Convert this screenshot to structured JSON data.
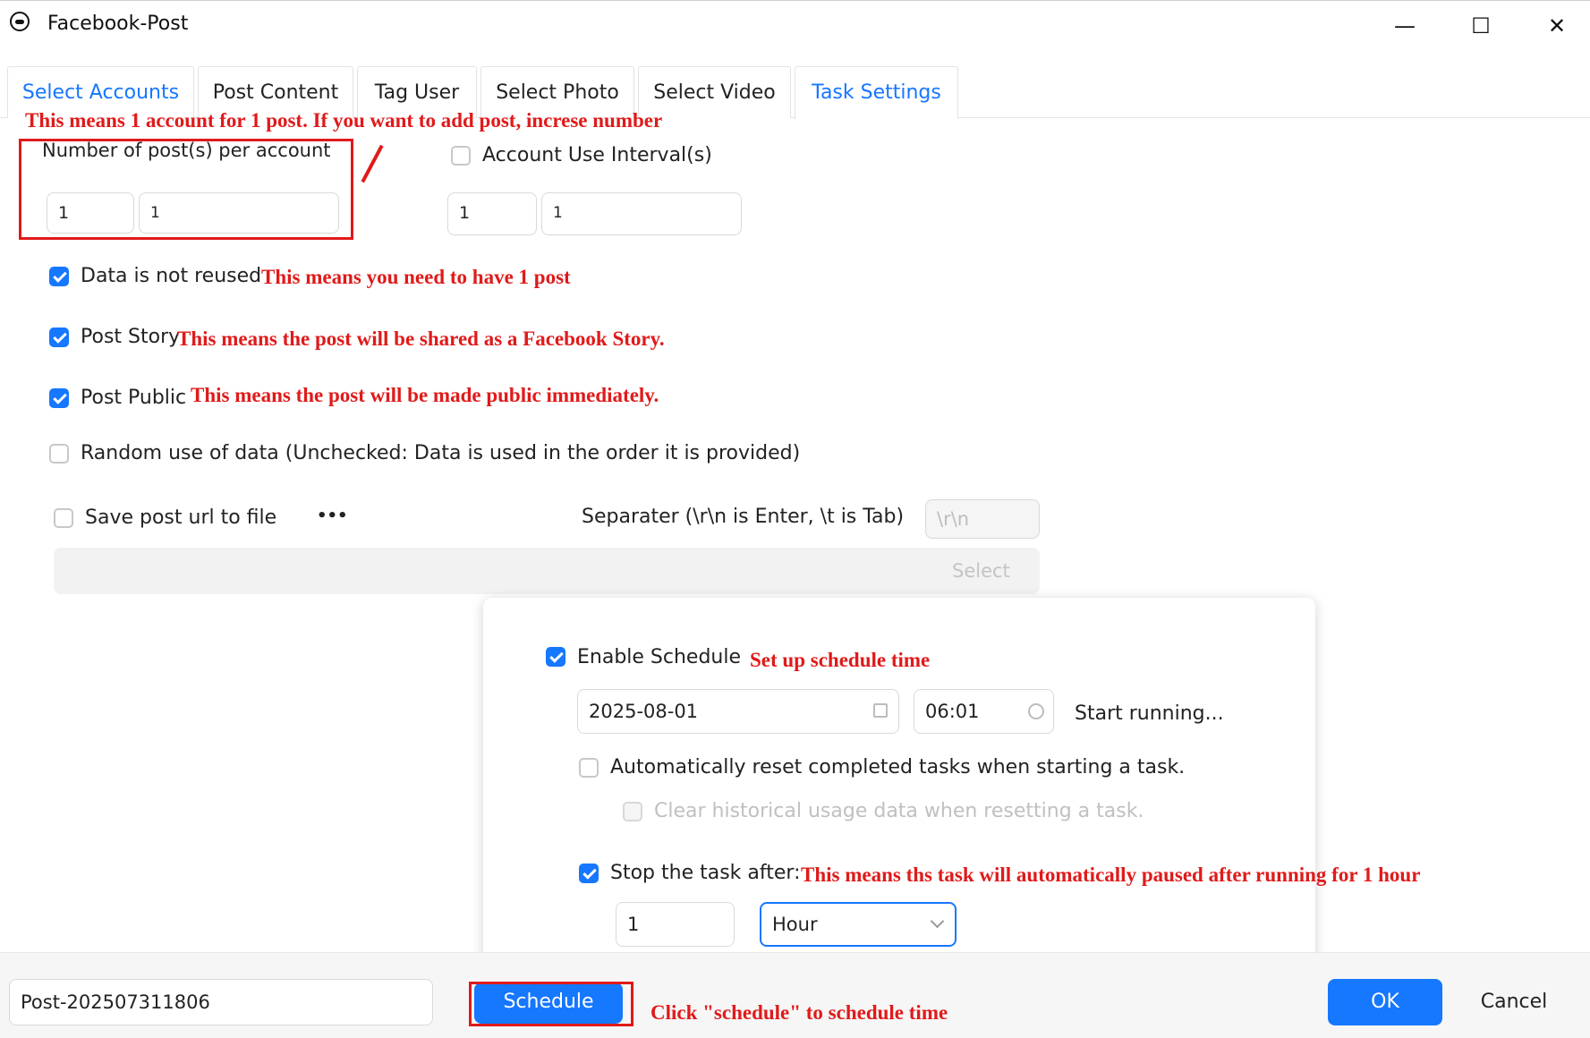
{
  "window": {
    "title": "Facebook-Post",
    "minimize_glyph": "—",
    "maximize_glyph": "☐",
    "close_glyph": "✕"
  },
  "tabs": [
    {
      "label": "Select Accounts"
    },
    {
      "label": "Post Content"
    },
    {
      "label": "Tag User"
    },
    {
      "label": "Select Photo"
    },
    {
      "label": "Select Video"
    },
    {
      "label": "Task Settings"
    }
  ],
  "settings": {
    "posts_per_account_label": "Number of post(s) per account",
    "posts_min": "1",
    "posts_max": "1",
    "interval_label": "Account Use Interval(s)",
    "interval_checked": false,
    "interval_min": "1",
    "interval_max": "1",
    "not_reused_label": "Data is not reused",
    "not_reused_checked": true,
    "post_story_label": "Post Story",
    "post_story_checked": true,
    "post_public_label": "Post Public",
    "post_public_checked": true,
    "random_label": "Random use of data (Unchecked: Data is used in the order it is provided)",
    "random_checked": false,
    "save_url_label": "Save post url to file",
    "save_url_checked": false,
    "more_glyph": "•••",
    "separator_label": "Separater (\\r\\n is Enter, \\t is Tab)",
    "separator_value": "\\r\\n",
    "select_button": "Select"
  },
  "schedule": {
    "enable_label": "Enable Schedule",
    "enable_checked": true,
    "date": "2025-08-01",
    "time": "06:01",
    "start_text": "Start running...",
    "auto_reset_label": "Automatically reset completed tasks when starting a task.",
    "auto_reset_checked": false,
    "clear_history_label": "Clear historical usage data when resetting a task.",
    "stop_after_label": "Stop the task after:",
    "stop_after_checked": true,
    "stop_value": "1",
    "stop_unit": "Hour"
  },
  "footer": {
    "task_name": "Post-202507311806",
    "schedule_button": "Schedule",
    "ok_button": "OK",
    "cancel_button": "Cancel"
  },
  "annotations": {
    "posts": "This means 1 account for 1 post. If you want to add post, increse number",
    "not_reused": "This means you need to have 1 post",
    "story": "This means the post will be shared as a Facebook Story.",
    "public": "This means the post will be made public immediately.",
    "schedule_time": "Set up schedule time",
    "stop_after": "This means ths task will automatically paused after running for 1 hour",
    "click_schedule": "Click \"schedule\" to schedule time"
  },
  "colors": {
    "accent": "#1677ff",
    "annotation": "#e01a1a"
  }
}
